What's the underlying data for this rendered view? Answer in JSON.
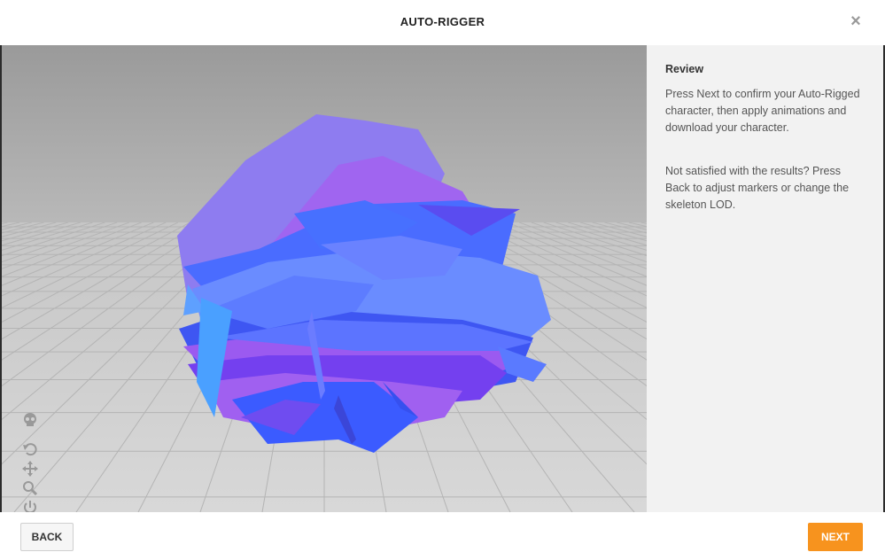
{
  "dialog": {
    "title": "AUTO-RIGGER"
  },
  "review": {
    "heading": "Review",
    "paragraph1": "Press Next to confirm your Auto-Rigged character, then apply animations and download your character.",
    "paragraph2": "Not satisfied with the results? Press Back to adjust markers or change the skeleton LOD."
  },
  "footer": {
    "back_label": "BACK",
    "next_label": "NEXT"
  },
  "toolbar": {
    "icons": [
      "skull-icon",
      "rotate-icon",
      "pan-icon",
      "zoom-icon",
      "power-icon",
      "camera-icon"
    ]
  },
  "colors": {
    "accent": "#f7931e",
    "sidebar_bg": "#f2f2f2",
    "mesh_violet": "#8e7cf0",
    "mesh_blue": "#3d63ff",
    "mesh_purple": "#7a3cf0"
  }
}
